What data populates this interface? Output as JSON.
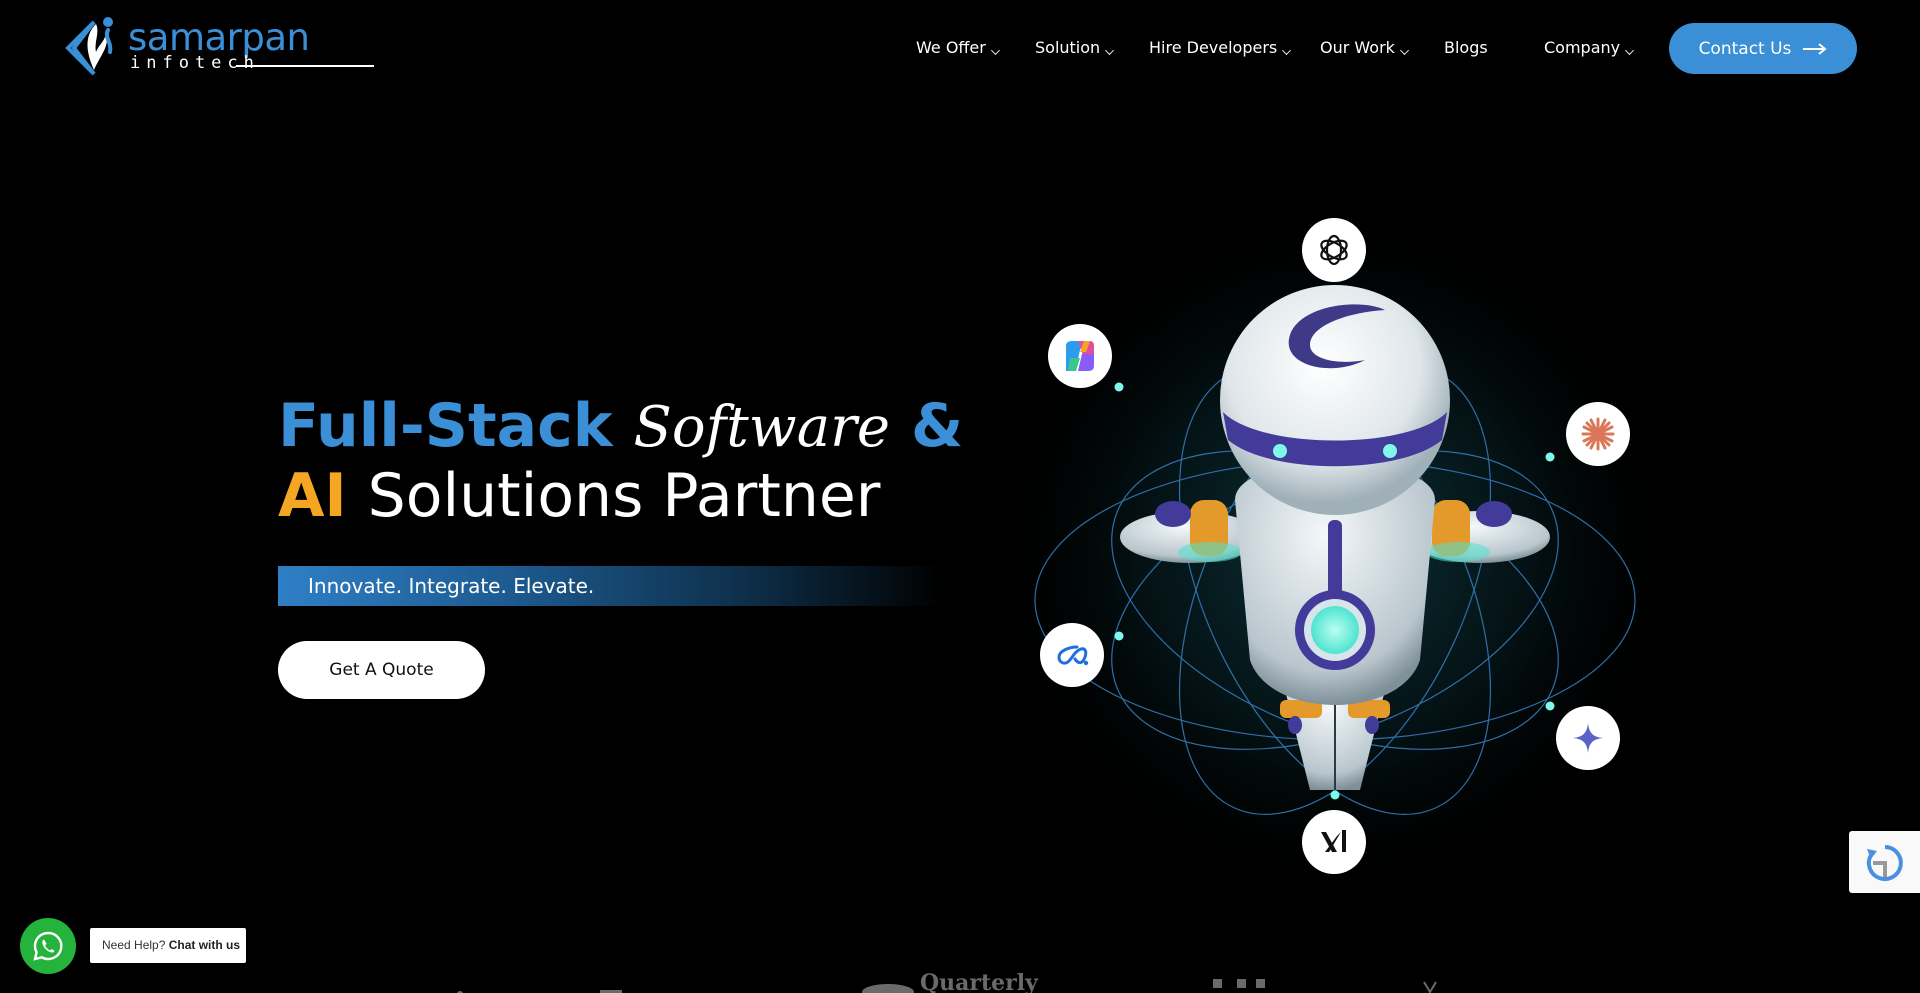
{
  "header": {
    "logo": {
      "word": "samarpan",
      "sub": "infotech"
    },
    "nav": [
      {
        "label": "We Offer",
        "dropdown": true
      },
      {
        "label": "Solution",
        "dropdown": true
      },
      {
        "label": "Hire Developers",
        "dropdown": true
      },
      {
        "label": "Our Work",
        "dropdown": true
      },
      {
        "label": "Blogs",
        "dropdown": false
      },
      {
        "label": "Company",
        "dropdown": true
      }
    ],
    "contact_label": "Contact Us"
  },
  "hero": {
    "title_part1": "Full-Stack",
    "title_part2": "Software",
    "title_part3": "&",
    "title_part4": "AI",
    "title_part5": "Solutions Partner",
    "tagline": "Innovate. Integrate. Elevate.",
    "cta_label": "Get A Quote"
  },
  "illustration": {
    "badges": [
      "openai-icon",
      "copilot-icon",
      "claude-icon",
      "meta-ai-icon",
      "gemini-icon",
      "xai-grok-icon"
    ]
  },
  "whatsapp": {
    "prefix": "Need Help?",
    "action": "Chat with us"
  },
  "partners": {
    "visible_text": "Quarterly"
  },
  "colors": {
    "accent_blue": "#3a8fd6",
    "accent_amber": "#f5a623",
    "background": "#000000",
    "whatsapp_green": "#25b33e"
  }
}
